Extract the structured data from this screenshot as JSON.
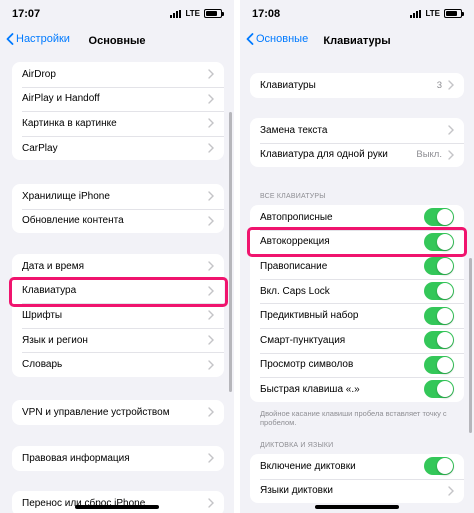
{
  "left": {
    "status": {
      "time": "17:07",
      "network": "LTE"
    },
    "nav": {
      "back_label": "Настройки",
      "title": "Основные"
    },
    "groups": [
      {
        "rows": [
          {
            "label": "AirDrop"
          },
          {
            "label": "AirPlay и Handoff"
          },
          {
            "label": "Картинка в картинке"
          },
          {
            "label": "CarPlay"
          }
        ]
      },
      {
        "rows": [
          {
            "label": "Хранилище iPhone"
          },
          {
            "label": "Обновление контента"
          }
        ]
      },
      {
        "rows": [
          {
            "label": "Дата и время"
          },
          {
            "label": "Клавиатура"
          },
          {
            "label": "Шрифты"
          },
          {
            "label": "Язык и регион"
          },
          {
            "label": "Словарь"
          }
        ]
      },
      {
        "rows": [
          {
            "label": "VPN и управление устройством"
          }
        ]
      },
      {
        "rows": [
          {
            "label": "Правовая информация"
          }
        ]
      },
      {
        "rows": [
          {
            "label": "Перенос или сброс iPhone"
          }
        ]
      }
    ]
  },
  "right": {
    "status": {
      "time": "17:08",
      "network": "LTE"
    },
    "nav": {
      "back_label": "Основные",
      "title": "Клавиатуры"
    },
    "groups": [
      {
        "rows": [
          {
            "label": "Клавиатуры",
            "value": "3"
          }
        ]
      },
      {
        "rows": [
          {
            "label": "Замена текста"
          },
          {
            "label": "Клавиатура для одной руки",
            "value": "Выкл."
          }
        ]
      },
      {
        "header": "ВСЕ КЛАВИАТУРЫ",
        "rows": [
          {
            "label": "Автопрописные",
            "on": true
          },
          {
            "label": "Автокоррекция",
            "on": true
          },
          {
            "label": "Правописание",
            "on": true
          },
          {
            "label": "Вкл. Caps Lock",
            "on": true
          },
          {
            "label": "Предиктивный набор",
            "on": true
          },
          {
            "label": "Смарт-пунктуация",
            "on": true
          },
          {
            "label": "Просмотр символов",
            "on": true
          },
          {
            "label": "Быстрая клавиша «.»",
            "on": true
          }
        ],
        "footer": "Двойное касание клавиши пробела вставляет точку с пробелом."
      },
      {
        "header": "ДИКТОВКА И ЯЗЫКИ",
        "rows": [
          {
            "label": "Включение диктовки",
            "on": true
          },
          {
            "label": "Языки диктовки"
          }
        ]
      }
    ]
  },
  "colors": {
    "accent": "#007aff",
    "toggle_on": "#34c759",
    "highlight": "#f0146e",
    "background": "#f2f2f7"
  }
}
